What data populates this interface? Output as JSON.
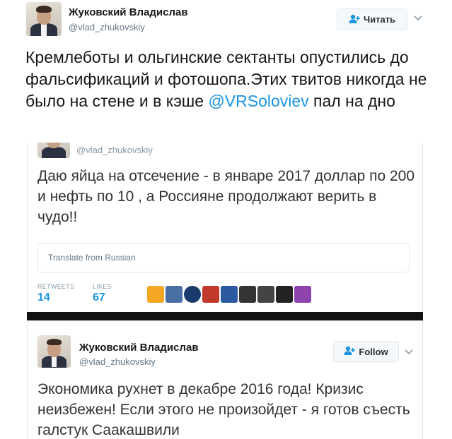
{
  "tweet": {
    "author_name": "Жуковский Владислав",
    "author_handle": "@vlad_zhukovskiy",
    "follow_label": "Читать",
    "text_before_mention": "Кремлеботы и ольгинские сектанты опустились до фальсификаций и фотошопа.Этих твитов никогда не было на стене и в кэше ",
    "mention": "@VRSoloviev",
    "text_after_mention": " пал на дно"
  },
  "embedded_upper": {
    "author_handle": "@vlad_zhukovskiy",
    "text": "Даю яйца на отсечение - в январе 2017 доллар по 200 и нефть по 10 , а Россияне продолжают верить в чудо!!",
    "translate_label": "Translate from Russian",
    "retweets_label": "RETWEETS",
    "retweets_value": "14",
    "likes_label": "LIKES",
    "likes_value": "67",
    "liker_colors": [
      "#f5a623",
      "#4a6fa5",
      "#1a3a6b",
      "#c0392b",
      "#2c5aa0",
      "#333333",
      "#444444",
      "#222222",
      "#8e44ad"
    ]
  },
  "embedded_lower": {
    "author_name": "Жуковский Владислав",
    "author_handle": "@vlad_zhukovskiy",
    "follow_label": "Follow",
    "text": "Экономика рухнет в декабре 2016 года! Кризис неизбежен! Если этого не произойдет - я готов съесть галстук Саакашвили"
  },
  "colors": {
    "link": "#1b95e0",
    "muted": "#657786",
    "border": "#e1e8ed"
  }
}
